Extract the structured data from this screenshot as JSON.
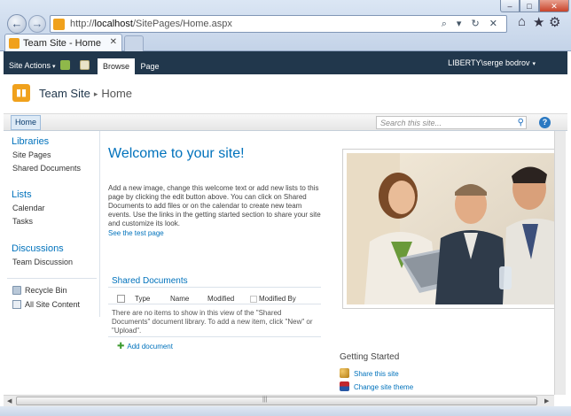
{
  "browser": {
    "url_prefix": "http://",
    "url_host": "localhost",
    "url_path": "/SitePages/Home.aspx",
    "url_actions": "⌕ ▾ ↻ ✕",
    "tab_title": "Team Site - Home",
    "back_icon": "←",
    "forward_icon": "→",
    "home_icon": "⌂",
    "favorites_icon": "★",
    "tools_icon": "⚙",
    "min_icon": "–",
    "max_icon": "□",
    "close_icon": "✕",
    "tab_close_icon": "✕"
  },
  "ribbon": {
    "site_actions": "Site Actions",
    "caret": "▾",
    "tabs": [
      "Browse",
      "Page"
    ],
    "user": "LIBERTY\\serge bodrov"
  },
  "title_area": {
    "site_title": "Team Site",
    "separator": "▸",
    "page_title": "Home"
  },
  "topnav": {
    "home": "Home",
    "search_placeholder": "Search this site...",
    "search_icon": "⚲",
    "help_icon": "?"
  },
  "quicklaunch": {
    "libraries_heading": "Libraries",
    "libraries": [
      "Site Pages",
      "Shared Documents"
    ],
    "lists_heading": "Lists",
    "lists": [
      "Calendar",
      "Tasks"
    ],
    "discussions_heading": "Discussions",
    "discussions": [
      "Team Discussion"
    ],
    "recycle_bin": "Recycle Bin",
    "all_site_content": "All Site Content"
  },
  "main": {
    "welcome": "Welcome to your site!",
    "intro": "Add a new image, change this welcome text or add new lists to this page by clicking the edit button above. You can click on Shared Documents to add files or on the calendar to create new team events. Use the links in the getting started section to share your site and customize its look.",
    "test_link": "See the test page",
    "shared_docs": {
      "title": "Shared Documents",
      "columns": [
        "Type",
        "Name",
        "Modified",
        "Modified By"
      ],
      "empty_message": "There are no items to show in this view of the \"Shared Documents\" document library. To add a new item, click \"New\" or \"Upload\".",
      "add_icon": "✚",
      "add_document": "Add document"
    },
    "getting_started": {
      "title": "Getting Started",
      "items": [
        "Share this site",
        "Change site theme"
      ]
    }
  },
  "scrollbar": {
    "left_arrow": "◀",
    "right_arrow": "▶",
    "grip": "|||"
  },
  "colors": {
    "ribbon": "#21374c",
    "link": "#0072bc",
    "brand_orange": "#f0a11c"
  }
}
